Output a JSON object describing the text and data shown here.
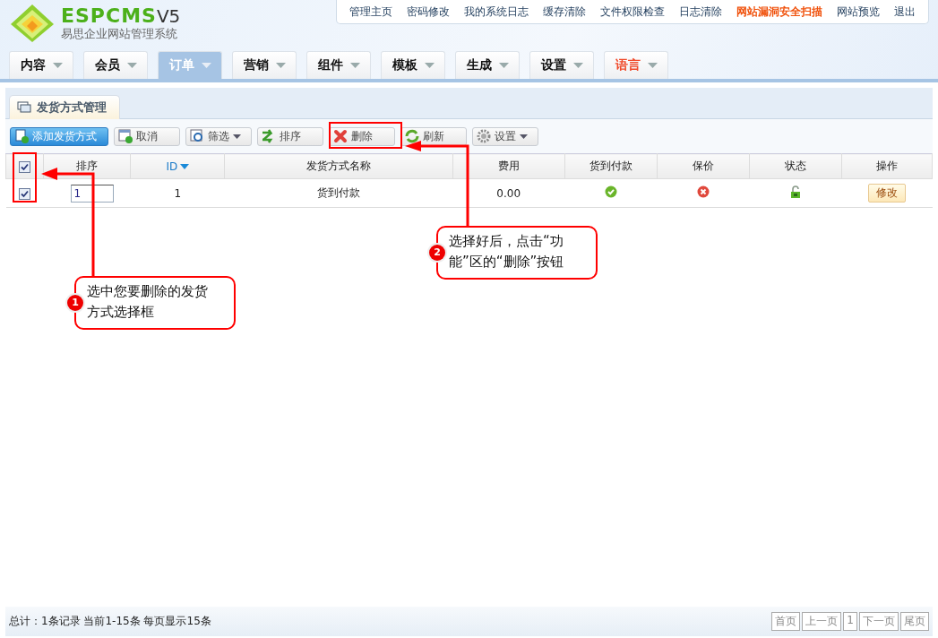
{
  "header": {
    "logo_text": "ESPCMS",
    "logo_version": "V5",
    "subtitle": "易思企业网站管理系统"
  },
  "top_links": [
    {
      "label": "管理主页",
      "highlighted": false
    },
    {
      "label": "密码修改",
      "highlighted": false
    },
    {
      "label": "我的系统日志",
      "highlighted": false
    },
    {
      "label": "缓存清除",
      "highlighted": false
    },
    {
      "label": "文件权限检查",
      "highlighted": false
    },
    {
      "label": "日志清除",
      "highlighted": false
    },
    {
      "label": "网站漏洞安全扫描",
      "highlighted": true
    },
    {
      "label": "网站预览",
      "highlighted": false
    },
    {
      "label": "退出",
      "highlighted": false
    }
  ],
  "nav": [
    {
      "label": "内容",
      "selected": false,
      "highlighted": false
    },
    {
      "label": "会员",
      "selected": false,
      "highlighted": false
    },
    {
      "label": "订单",
      "selected": true,
      "highlighted": false
    },
    {
      "label": "营销",
      "selected": false,
      "highlighted": false
    },
    {
      "label": "组件",
      "selected": false,
      "highlighted": false
    },
    {
      "label": "模板",
      "selected": false,
      "highlighted": false
    },
    {
      "label": "生成",
      "selected": false,
      "highlighted": false
    },
    {
      "label": "设置",
      "selected": false,
      "highlighted": false
    },
    {
      "label": "语言",
      "selected": false,
      "highlighted": true
    }
  ],
  "page_tab": {
    "label": "发货方式管理"
  },
  "toolbar": [
    {
      "label": "添加发货方式",
      "kind": "add",
      "dropdown": false
    },
    {
      "label": "取消",
      "kind": "cancel",
      "dropdown": false
    },
    {
      "label": "筛选",
      "kind": "filter",
      "dropdown": true
    },
    {
      "label": "排序",
      "kind": "sort",
      "dropdown": false
    },
    {
      "label": "删除",
      "kind": "delete",
      "dropdown": false
    },
    {
      "label": "刷新",
      "kind": "refresh",
      "dropdown": false
    },
    {
      "label": "设置",
      "kind": "gear",
      "dropdown": true
    }
  ],
  "table": {
    "select_all_checked": true,
    "columns": [
      {
        "label": "排序",
        "sorted": false
      },
      {
        "label": "ID",
        "sorted": true
      },
      {
        "label": "发货方式名称",
        "sorted": false
      },
      {
        "label": "费用",
        "sorted": false
      },
      {
        "label": "货到付款",
        "sorted": false
      },
      {
        "label": "保价",
        "sorted": false
      },
      {
        "label": "状态",
        "sorted": false
      },
      {
        "label": "操作",
        "sorted": false
      }
    ],
    "rows": [
      {
        "checked": true,
        "order": "1",
        "id": "1",
        "name": "货到付款",
        "fee": "0.00",
        "cod": true,
        "insured": false,
        "locked": false,
        "action": "修改"
      }
    ]
  },
  "annotations": [
    {
      "number": "1",
      "text": "选中您要删除的发货方式选择框"
    },
    {
      "number": "2",
      "text": "选择好后，点击“功能”区的“删除”按钮"
    }
  ],
  "status_bar": {
    "summary": "总计：1条记录 当前1-15条 每页显示15条",
    "pager": [
      {
        "label": "首页"
      },
      {
        "label": "上一页"
      },
      {
        "label": "1"
      },
      {
        "label": "下一页"
      },
      {
        "label": "尾页"
      }
    ]
  }
}
